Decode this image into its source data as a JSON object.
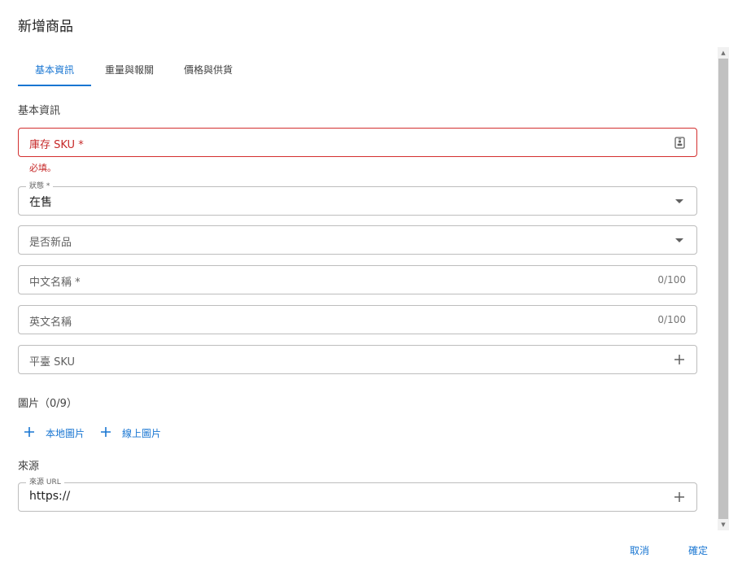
{
  "dialog": {
    "title": "新增商品"
  },
  "tabs": [
    {
      "label": "基本資訊",
      "active": true
    },
    {
      "label": "重量與報關",
      "active": false
    },
    {
      "label": "價格與供貨",
      "active": false
    }
  ],
  "sections": {
    "basic": "基本資訊",
    "images": "圖片（0/9）",
    "source": "來源"
  },
  "fields": {
    "sku": {
      "placeholder": "庫存 SKU *",
      "error": "必填。",
      "icon": "badge-icon"
    },
    "status": {
      "label": "狀態 *",
      "value": "在售",
      "icon": "chevron-down-icon"
    },
    "is_new": {
      "placeholder": "是否新品",
      "icon": "chevron-down-icon"
    },
    "name_zh": {
      "placeholder": "中文名稱 *",
      "counter": "0/100"
    },
    "name_en": {
      "placeholder": "英文名稱",
      "counter": "0/100"
    },
    "platform_sku": {
      "placeholder": "平臺 SKU",
      "icon": "plus-icon"
    },
    "source_url": {
      "label": "來源 URL",
      "value": "https://",
      "icon": "plus-icon"
    }
  },
  "image_buttons": {
    "local": "本地圖片",
    "online": "線上圖片"
  },
  "footer": {
    "cancel": "取消",
    "confirm": "確定"
  },
  "colors": {
    "primary": "#1976d2",
    "error": "#d32f2f",
    "border": "#bdbdbd"
  }
}
